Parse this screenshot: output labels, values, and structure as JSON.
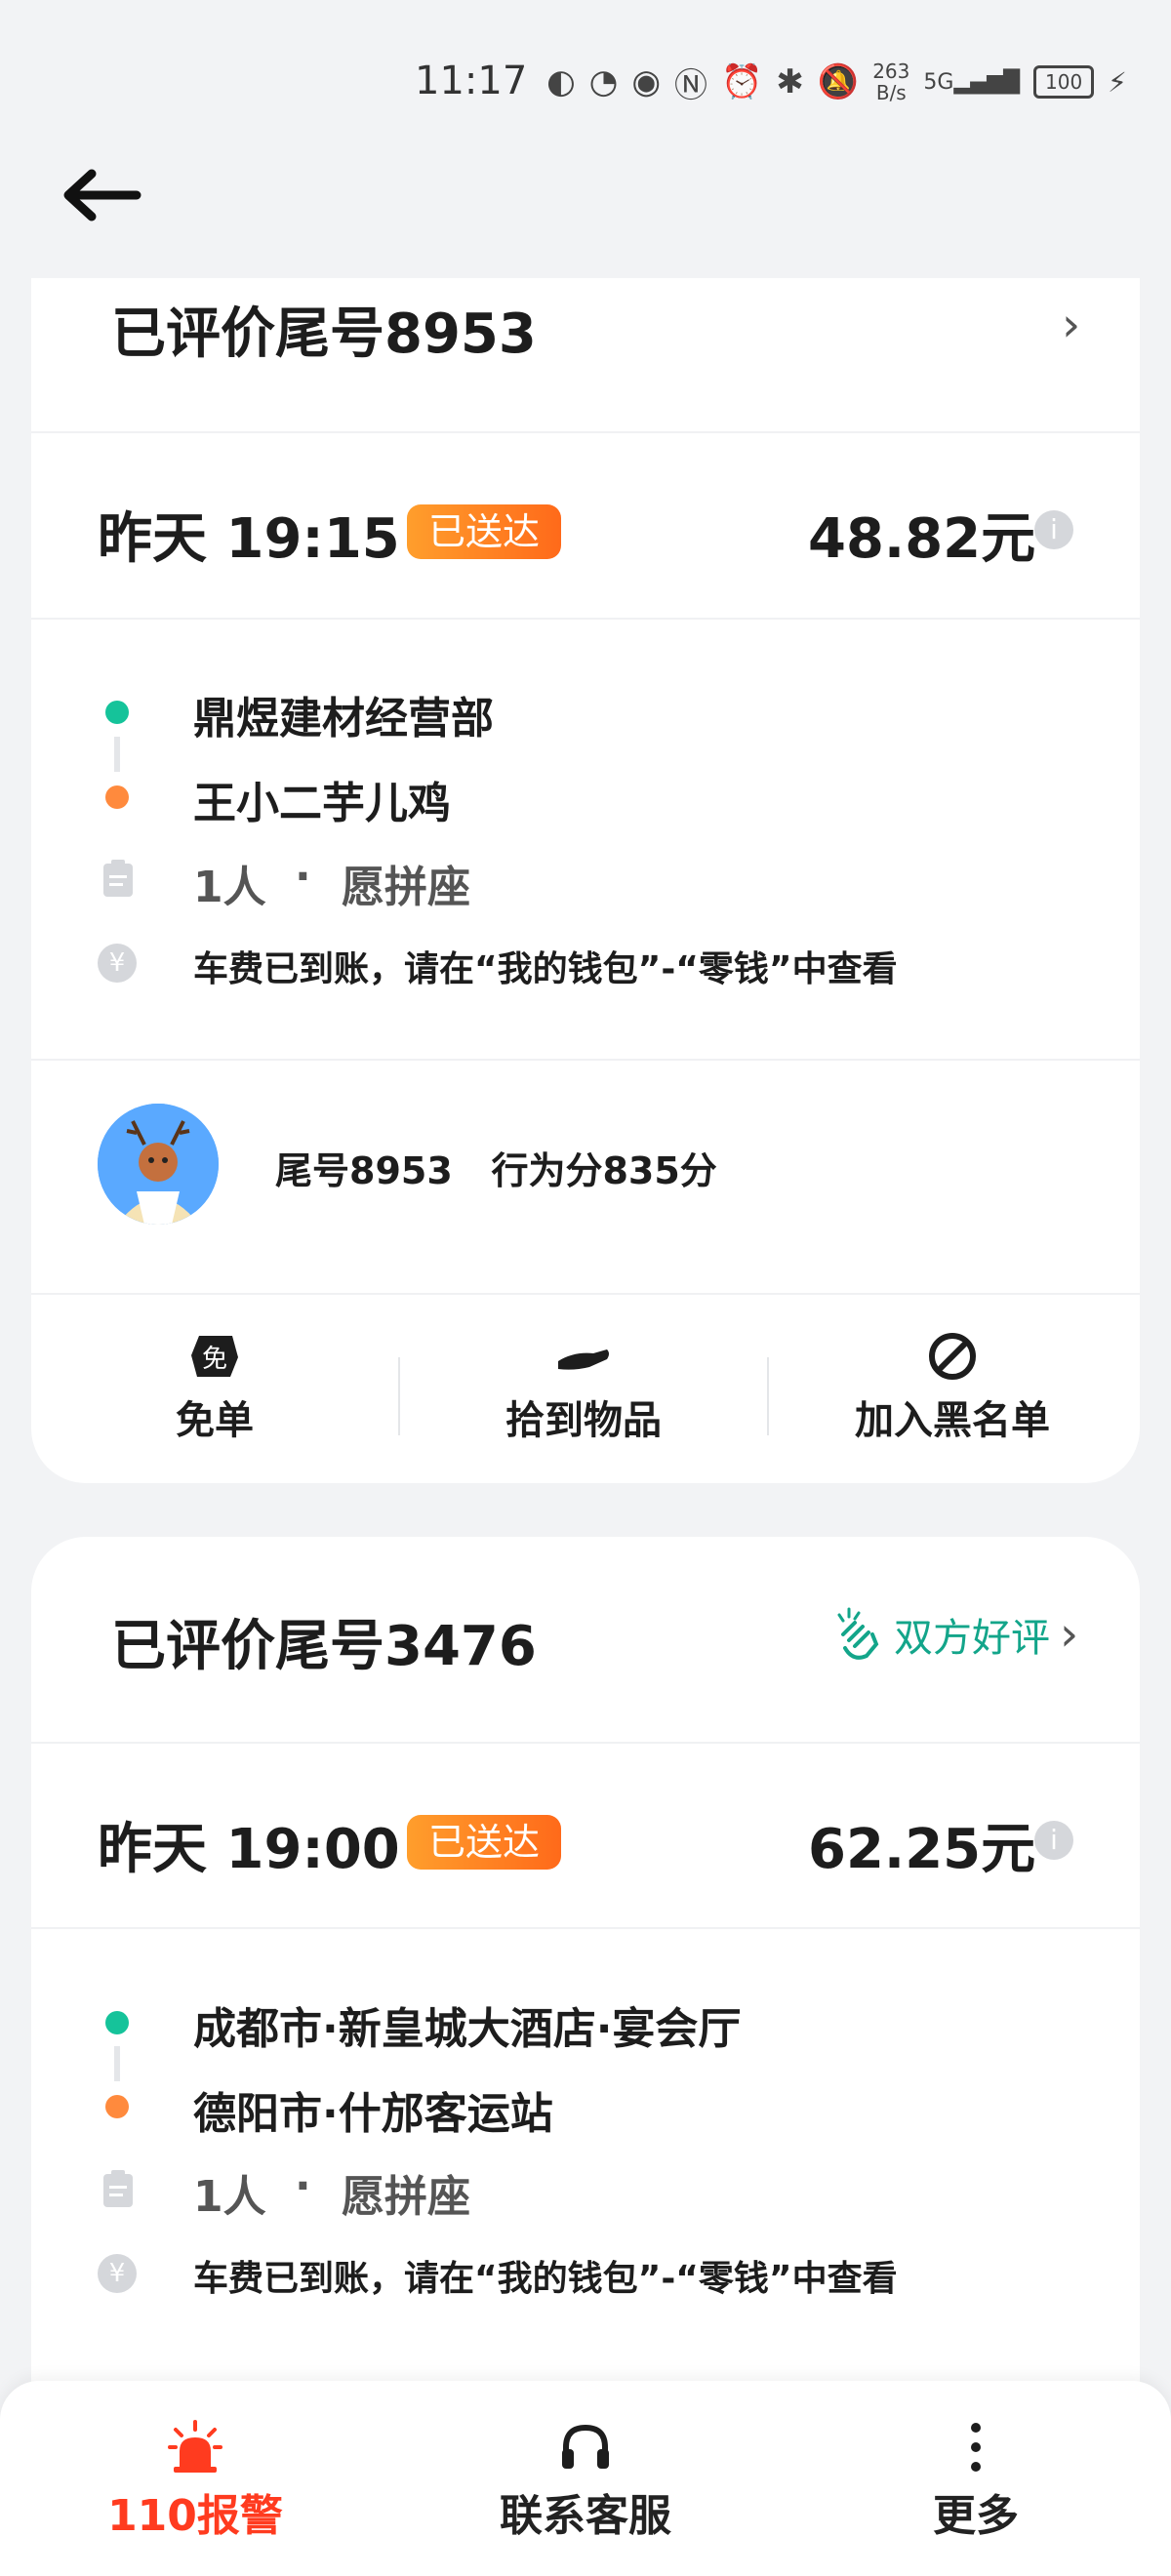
{
  "status_bar": {
    "time": "11:17",
    "speed_value": "263",
    "speed_unit": "B/s",
    "network": "5G",
    "battery": "100"
  },
  "orders": [
    {
      "title": "已评价尾号8953",
      "time": "昨天 19:15",
      "status": "已送达",
      "price": "48.82元",
      "from": "鼎煜建材经营部",
      "to": "王小二芋儿鸡",
      "passengers": "1人",
      "seat_pref": "愿拼座",
      "separator": "·",
      "payment_note": "车费已到账，请在“我的钱包”-“零钱”中查看",
      "driver_info": "尾号8953   行为分835分",
      "actions": [
        {
          "label": "免单",
          "icon": "free-ticket-icon"
        },
        {
          "label": "拾到物品",
          "icon": "hand-icon"
        },
        {
          "label": "加入黑名单",
          "icon": "block-icon"
        }
      ]
    },
    {
      "title": "已评价尾号3476",
      "praise_label": "双方好评",
      "time": "昨天 19:00",
      "status": "已送达",
      "price": "62.25元",
      "from": "成都市·新皇城大酒店·宴会厅",
      "to": "德阳市·什邡客运站",
      "passengers": "1人",
      "seat_pref": "愿拼座",
      "separator": "·",
      "payment_note": "车费已到账，请在“我的钱包”-“零钱”中查看"
    }
  ],
  "bottom_bar": {
    "alarm_label": "110报警",
    "service_label": "联系客服",
    "more_label": "更多"
  },
  "colors": {
    "accent_orange": "#ff6a1a",
    "green": "#15c39a",
    "alarm_red": "#ff3b1f"
  }
}
